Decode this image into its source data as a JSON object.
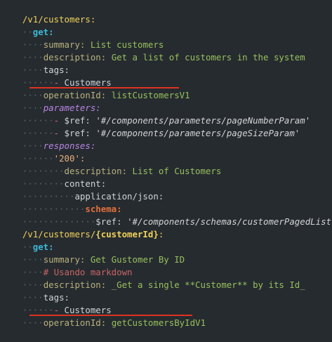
{
  "lines": [
    {
      "path": "/v1/customers:"
    },
    {
      "key": "get:"
    },
    {
      "key": "summary:",
      "value": "List customers"
    },
    {
      "key": "description:",
      "value": "Get a list of customers in the system"
    },
    {
      "key": "tags:"
    },
    {
      "dash": "-",
      "value": "Customers"
    },
    {
      "key": "operationId:",
      "value": "listCustomersV1"
    },
    {
      "key": "parameters:"
    },
    {
      "dash": "-",
      "key": "$ref:",
      "value": "'#/components/parameters/pageNumberParam'"
    },
    {
      "dash": "-",
      "key": "$ref:",
      "value": "'#/components/parameters/pageSizeParam'"
    },
    {
      "key": "responses:"
    },
    {
      "key": "'200':"
    },
    {
      "key": "description:",
      "value": "List of Customers"
    },
    {
      "key": "content:"
    },
    {
      "key": "application/json:"
    },
    {
      "key": "schema:"
    },
    {
      "key": "$ref:",
      "value": "'#/components/schemas/customerPagedList'"
    },
    {
      "path_a": "/v1/customers/",
      "path_b": "{customerId}",
      "path_c": ":"
    },
    {
      "key": "get:"
    },
    {
      "key": "summary:",
      "value": "Get Gustomer By ID"
    },
    {
      "comment": "# Usando markdown"
    },
    {
      "key": "description:",
      "value": "_Get a single **Customer** by its Id_"
    },
    {
      "key": "tags:"
    },
    {
      "dash": "-",
      "value": "Customers"
    },
    {
      "key": "operationId:",
      "value": "getCustomersByIdV1"
    }
  ]
}
